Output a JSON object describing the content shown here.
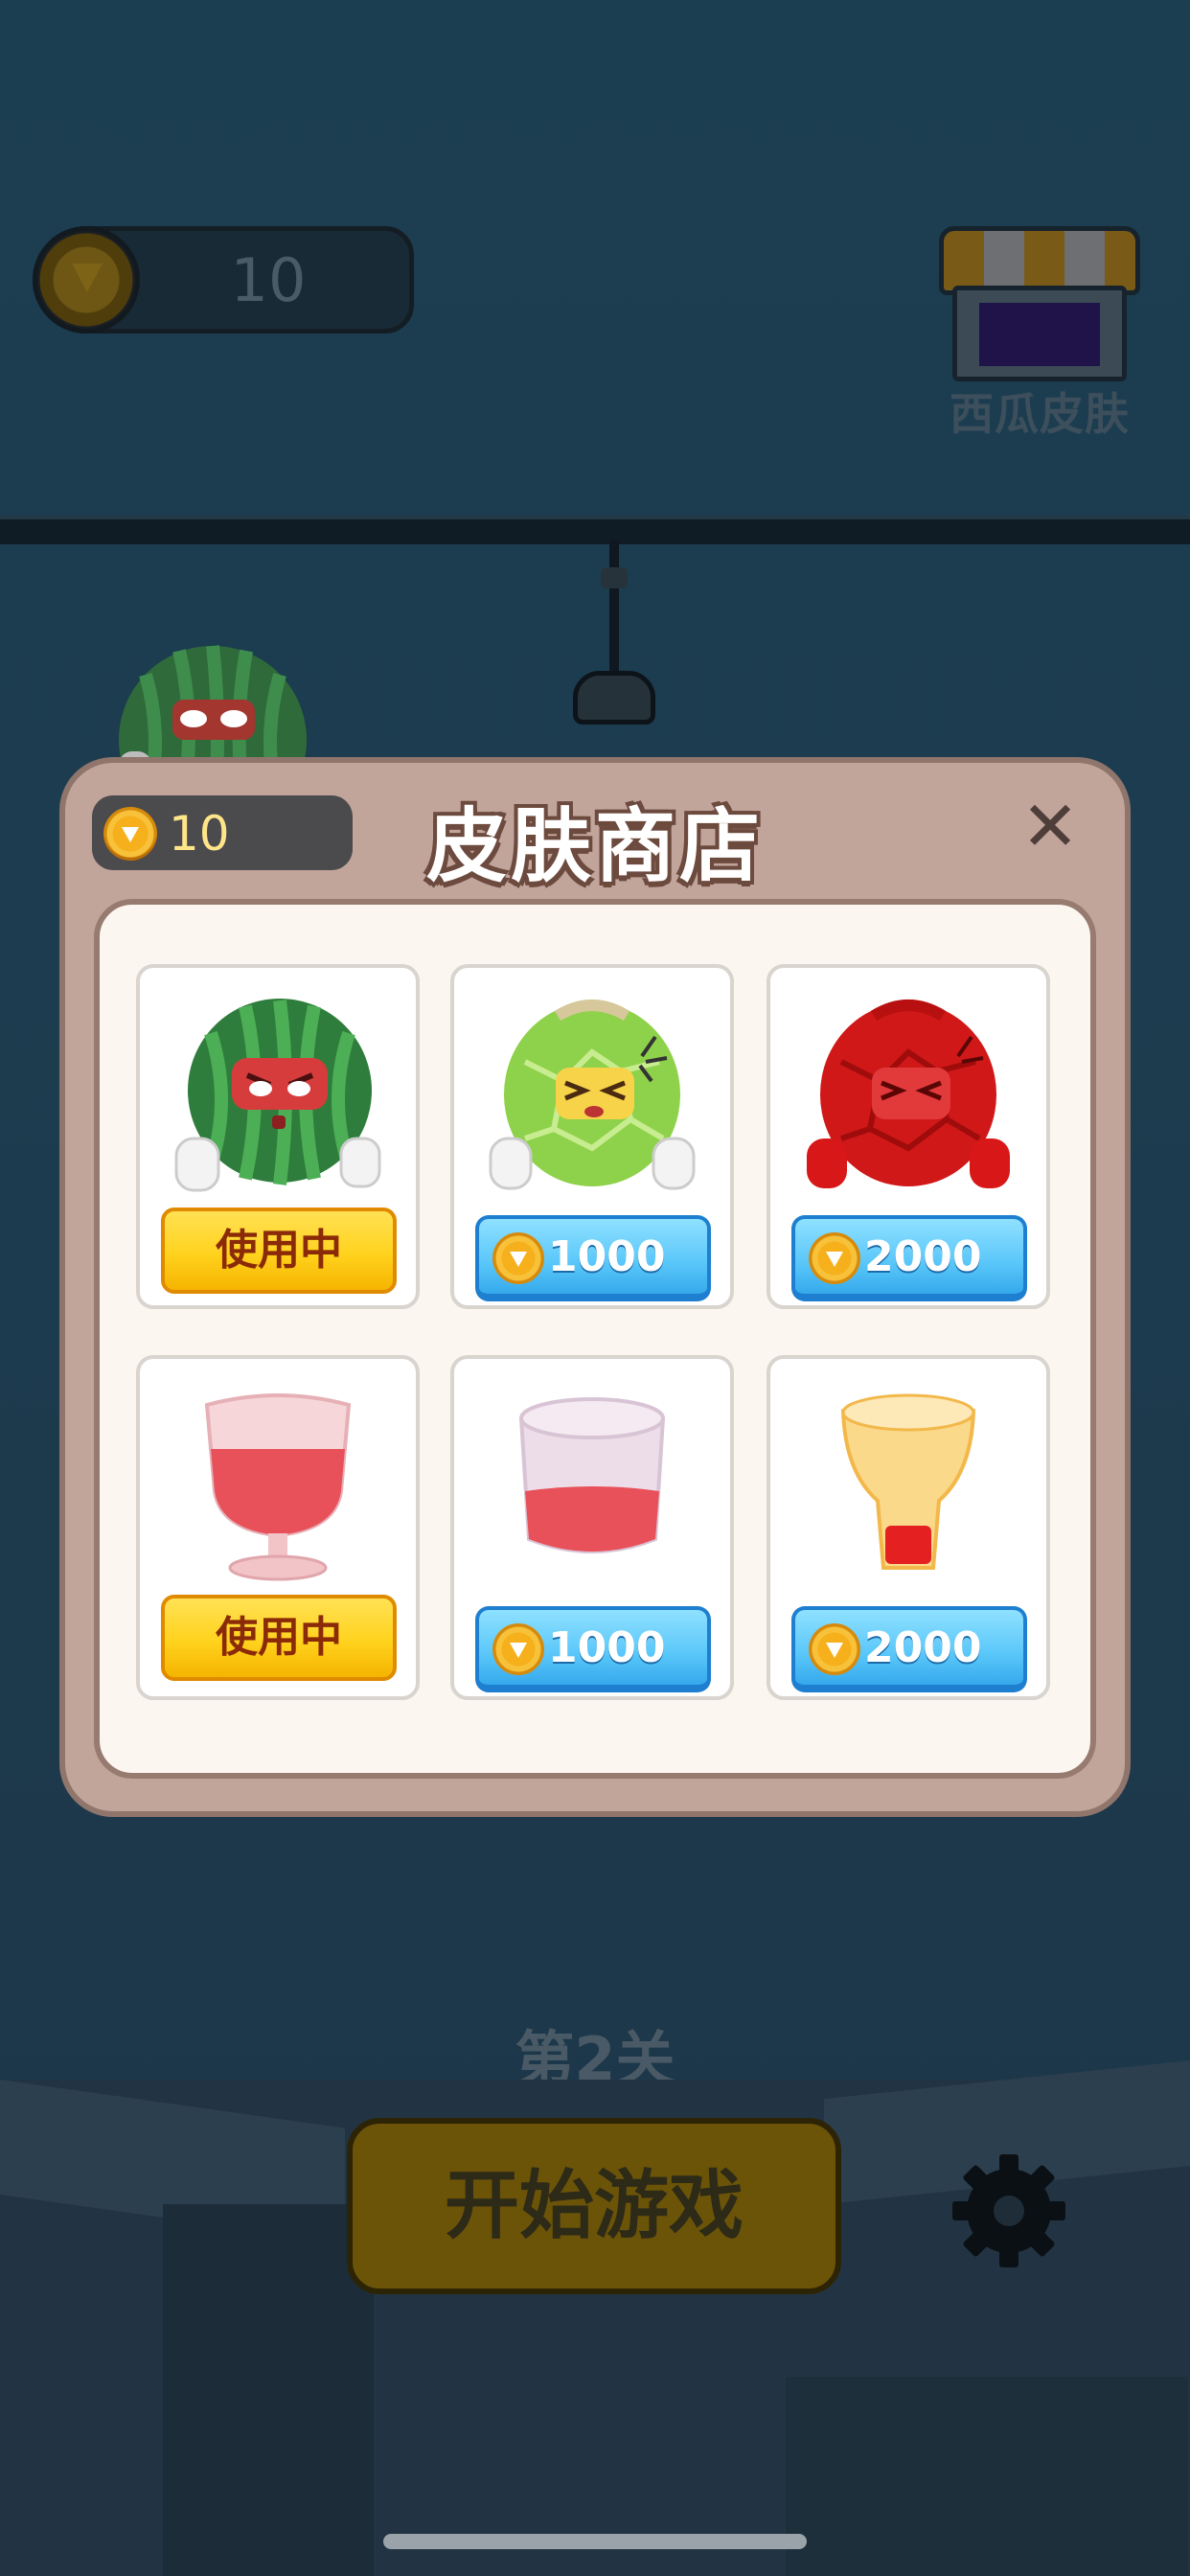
{
  "hud": {
    "coins": "10",
    "shop_label": "西瓜皮肤"
  },
  "level": "第2关",
  "start_button": "开始游戏",
  "modal": {
    "title": "皮肤商店",
    "coins": "10",
    "close_symbol": "✕",
    "items": [
      {
        "name": "watermelon",
        "status": "使用中"
      },
      {
        "name": "green-melon",
        "price": "1000"
      },
      {
        "name": "red-melon",
        "price": "2000"
      },
      {
        "name": "wine-glass",
        "status": "使用中"
      },
      {
        "name": "round-glass",
        "price": "1000"
      },
      {
        "name": "bulb-glass",
        "price": "2000"
      }
    ]
  },
  "colors": {
    "use_button": "#ffd21d",
    "price_button": "#59c6f9",
    "modal_frame": "#c1a49a"
  }
}
